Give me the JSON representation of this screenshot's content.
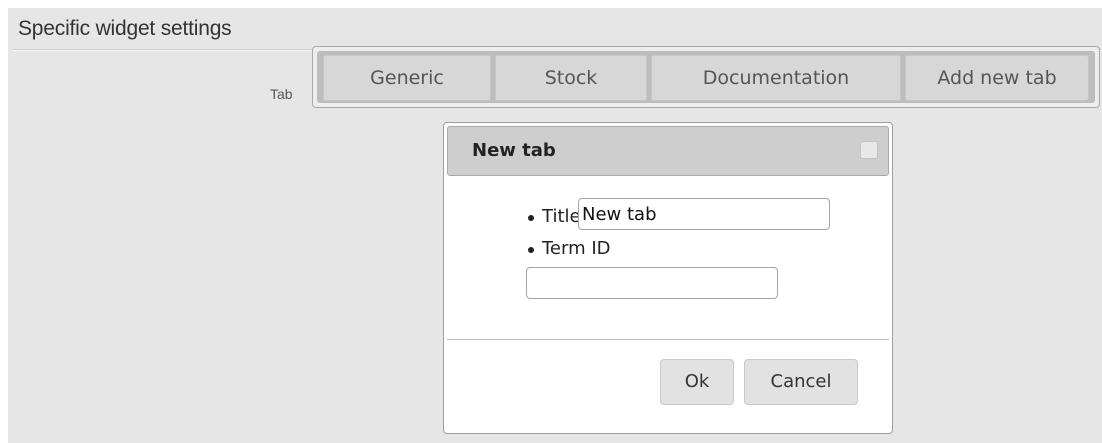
{
  "section": {
    "title": "Specific widget settings",
    "tab_field_label": "Tab"
  },
  "tabs": [
    {
      "label": "Generic"
    },
    {
      "label": "Stock"
    },
    {
      "label": "Documentation"
    },
    {
      "label": "Add new tab"
    }
  ],
  "dialog": {
    "title": "New tab",
    "fields": [
      {
        "label": "Title",
        "value": "New tab"
      },
      {
        "label": "Term ID",
        "value": ""
      }
    ],
    "buttons": {
      "ok": "Ok",
      "cancel": "Cancel"
    }
  },
  "colors": {
    "panel_background": "#e6e6e6",
    "tab_background": "#d7d7d7",
    "dialog_header": "#cecece"
  }
}
